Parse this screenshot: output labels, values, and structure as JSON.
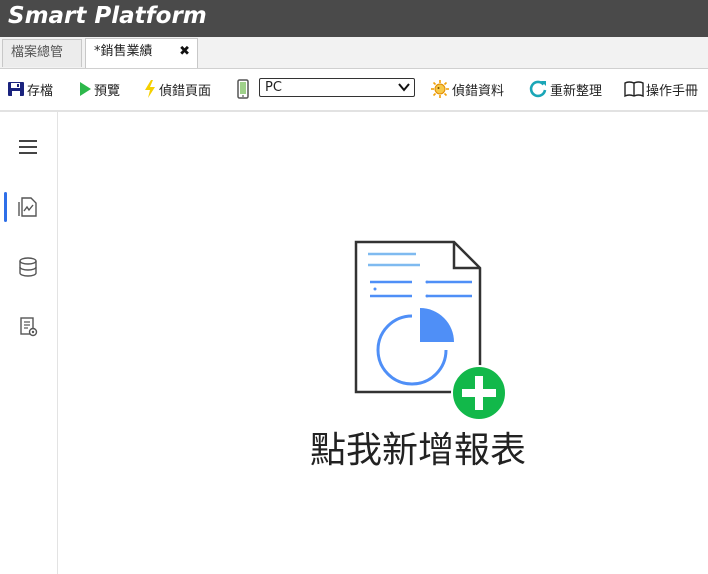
{
  "app": {
    "title": "Smart Platform"
  },
  "tabs": [
    {
      "label": "檔案總管"
    },
    {
      "label": "*銷售業績",
      "close_icon": "close-icon"
    }
  ],
  "toolbar": {
    "save_label": "存檔",
    "preview_label": "預覽",
    "debug_page_label": "偵錯頁面",
    "device_icon": "mobile-device-icon",
    "device_select_value": "PC",
    "debug_data_label": "偵錯資料",
    "refresh_label": "重新整理",
    "manual_label": "操作手冊"
  },
  "sidebar": {
    "items": [
      {
        "name": "menu",
        "icon": "hamburger-menu-icon"
      },
      {
        "name": "report-designer",
        "icon": "report-chart-icon",
        "active": true
      },
      {
        "name": "database",
        "icon": "database-icon"
      },
      {
        "name": "report-settings",
        "icon": "report-settings-icon"
      }
    ]
  },
  "main": {
    "empty_state_label": "點我新增報表",
    "illustration_icon": "add-report-icon"
  },
  "colors": {
    "titlebar_bg": "#4a4a4a",
    "accent_blue": "#2f6fe8",
    "add_green": "#12b84a",
    "chart_blue": "#4f8ff7",
    "line_light_blue": "#7fbaf0"
  }
}
